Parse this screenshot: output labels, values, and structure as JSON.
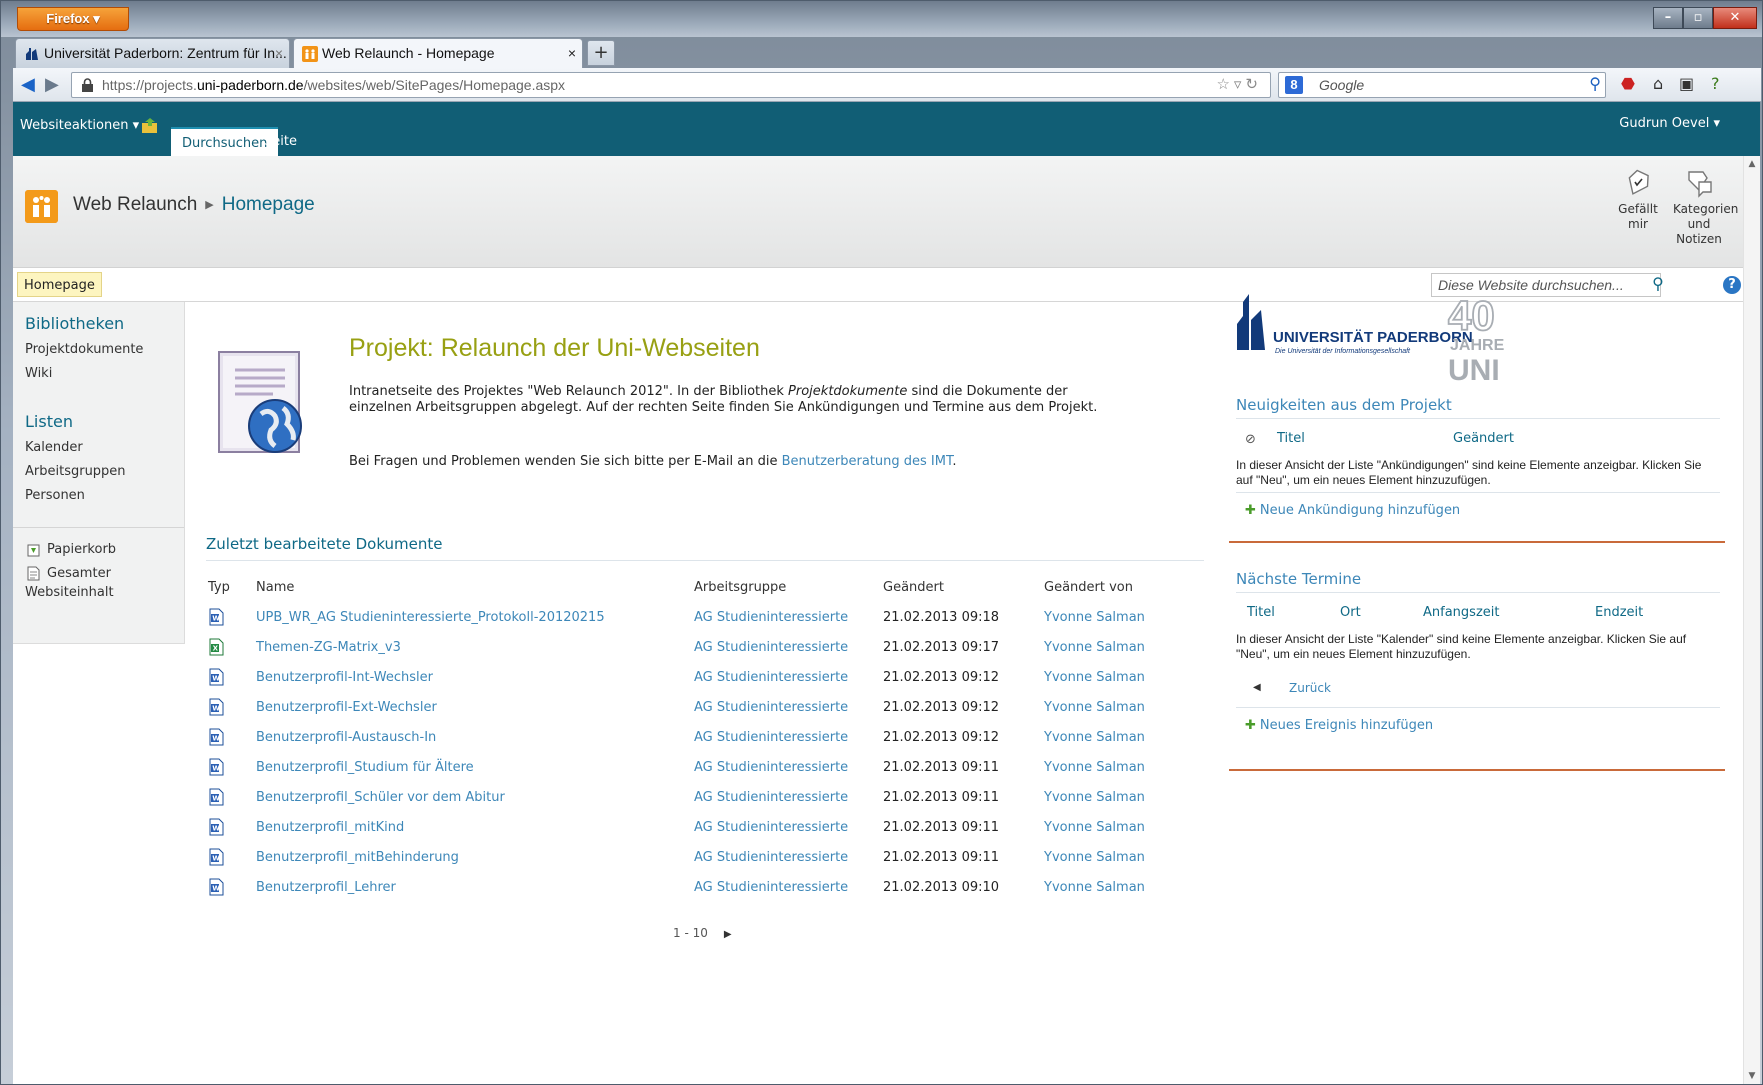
{
  "browser": {
    "app_button": "Firefox",
    "tabs": [
      {
        "title": "Universität Paderborn: Zentrum für In...",
        "active": false
      },
      {
        "title": "Web Relaunch - Homepage",
        "active": true
      }
    ],
    "url_prefix": "https://projects.",
    "url_domain": "uni-paderborn.de",
    "url_path": "/websites/web/SitePages/Homepage.aspx",
    "search_placeholder": "Google"
  },
  "ribbon": {
    "site_actions": "Websiteaktionen",
    "tabs": [
      "Durchsuchen",
      "Seite"
    ],
    "user": "Gudrun Oevel"
  },
  "title_area": {
    "site": "Web Relaunch",
    "page": "Homepage",
    "actions": [
      {
        "label": "Gefällt mir",
        "icon": "like-tag-icon"
      },
      {
        "label": "Kategorien und Notizen",
        "icon": "tags-notes-icon"
      }
    ]
  },
  "topnav": {
    "home": "Homepage",
    "search_placeholder": "Diese Website durchsuchen..."
  },
  "quicklaunch": {
    "libraries_heading": "Bibliotheken",
    "libraries": [
      "Projektdokumente",
      "Wiki"
    ],
    "lists_heading": "Listen",
    "lists": [
      "Kalender",
      "Arbeitsgruppen",
      "Personen"
    ],
    "recycle_bin": "Papierkorb",
    "all_content_line1": "Gesamter",
    "all_content_line2": "Websiteinhalt"
  },
  "main": {
    "title": "Projekt: Relaunch der Uni-Webseiten",
    "desc_part1": "Intranetseite des Projektes \"Web Relaunch 2012\". In der Bibliothek ",
    "desc_italic": "Projektdokumente",
    "desc_part2": " sind die Dokumente der einzelnen Arbeitsgruppen abgelegt. Auf der rechten Seite finden Sie Ankündigungen und Termine aus dem Projekt.",
    "contact_text": "Bei Fragen und Problemen wenden Sie sich bitte per E-Mail an die ",
    "contact_link": "Benutzerberatung des IMT",
    "contact_end": "."
  },
  "recent_docs": {
    "title": "Zuletzt bearbeitete Dokumente",
    "columns": [
      "Typ",
      "Name",
      "Arbeitsgruppe",
      "Geändert",
      "Geändert von"
    ],
    "rows": [
      {
        "type": "word",
        "name": "UPB_WR_AG Studieninteressierte_Protokoll-20120215",
        "group": "AG Studieninteressierte",
        "modified": "21.02.2013 09:18",
        "by": "Yvonne Salman"
      },
      {
        "type": "excel",
        "name": "Themen-ZG-Matrix_v3",
        "group": "AG Studieninteressierte",
        "modified": "21.02.2013 09:17",
        "by": "Yvonne Salman"
      },
      {
        "type": "word",
        "name": "Benutzerprofil-Int-Wechsler",
        "group": "AG Studieninteressierte",
        "modified": "21.02.2013 09:12",
        "by": "Yvonne Salman"
      },
      {
        "type": "word",
        "name": "Benutzerprofil-Ext-Wechsler",
        "group": "AG Studieninteressierte",
        "modified": "21.02.2013 09:12",
        "by": "Yvonne Salman"
      },
      {
        "type": "word",
        "name": "Benutzerprofil-Austausch-In",
        "group": "AG Studieninteressierte",
        "modified": "21.02.2013 09:12",
        "by": "Yvonne Salman"
      },
      {
        "type": "word",
        "name": "Benutzerprofil_Studium für Ältere",
        "group": "AG Studieninteressierte",
        "modified": "21.02.2013 09:11",
        "by": "Yvonne Salman"
      },
      {
        "type": "word",
        "name": "Benutzerprofil_Schüler vor dem Abitur",
        "group": "AG Studieninteressierte",
        "modified": "21.02.2013 09:11",
        "by": "Yvonne Salman"
      },
      {
        "type": "word",
        "name": "Benutzerprofil_mitKind",
        "group": "AG Studieninteressierte",
        "modified": "21.02.2013 09:11",
        "by": "Yvonne Salman"
      },
      {
        "type": "word",
        "name": "Benutzerprofil_mitBehinderung",
        "group": "AG Studieninteressierte",
        "modified": "21.02.2013 09:11",
        "by": "Yvonne Salman"
      },
      {
        "type": "word",
        "name": "Benutzerprofil_Lehrer",
        "group": "AG Studieninteressierte",
        "modified": "21.02.2013 09:10",
        "by": "Yvonne Salman"
      }
    ],
    "pager": "1 - 10"
  },
  "right": {
    "logo_name": "UNIVERSITÄT PADERBORN",
    "logo_tagline": "Die Universität der Informationsgesellschaft",
    "logo_years": "40",
    "logo_jahre": "JAHRE",
    "logo_uni": "UNI",
    "news": {
      "title": "Neuigkeiten aus dem Projekt",
      "columns": [
        "Titel",
        "Geändert"
      ],
      "empty": "In dieser Ansicht der Liste \"Ankündigungen\" sind keine Elemente anzeigbar. Klicken Sie auf \"Neu\", um ein neues Element hinzuzufügen.",
      "add": "Neue Ankündigung hinzufügen"
    },
    "events": {
      "title": "Nächste Termine",
      "columns": [
        "Titel",
        "Ort",
        "Anfangszeit",
        "Endzeit"
      ],
      "empty": "In dieser Ansicht der Liste \"Kalender\" sind keine Elemente anzeigbar. Klicken Sie auf \"Neu\", um ein neues Element hinzuzufügen.",
      "back": "Zurück",
      "add": "Neues Ereignis hinzufügen"
    }
  },
  "colors": {
    "ribbon": "#115e75",
    "title_accent": "#98a013",
    "link": "#3d87b8",
    "heading": "#0f6986"
  }
}
